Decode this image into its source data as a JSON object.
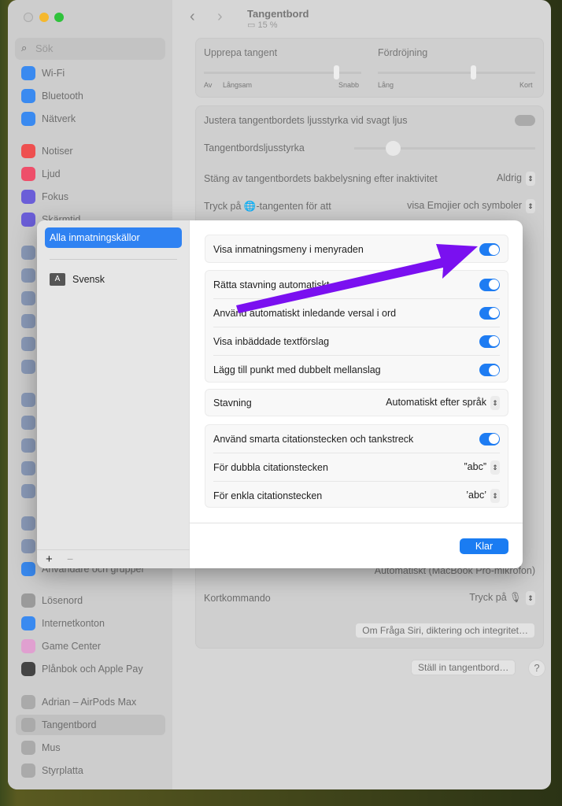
{
  "window": {
    "title": "Tangentbord",
    "battery": "15 %"
  },
  "sidebar": {
    "search_placeholder": "Sök",
    "items": [
      {
        "label": "Wi-Fi",
        "color": "#3a8af0"
      },
      {
        "label": "Bluetooth",
        "color": "#3a8af0"
      },
      {
        "label": "Nätverk",
        "color": "#3a8af0"
      },
      {
        "label": "Notiser",
        "color": "#ee5050"
      },
      {
        "label": "Ljud",
        "color": "#ee4f6a"
      },
      {
        "label": "Fokus",
        "color": "#6b5ed8"
      },
      {
        "label": "Skärmtid",
        "color": "#6b5ed8"
      },
      {
        "label": "Användare och grupper",
        "color": "#3a8af0"
      },
      {
        "label": "Lösenord",
        "color": "#9a9a9a"
      },
      {
        "label": "Internetkonton",
        "color": "#3a8af0"
      },
      {
        "label": "Game Center",
        "color": "#e0a0d0"
      },
      {
        "label": "Plånbok och Apple Pay",
        "color": "#444"
      },
      {
        "label": "Adrian – AirPods Max",
        "color": "#aaa"
      },
      {
        "label": "Tangentbord",
        "color": "#aaa",
        "selected": true
      },
      {
        "label": "Mus",
        "color": "#aaa"
      },
      {
        "label": "Styrplatta",
        "color": "#aaa"
      }
    ]
  },
  "main": {
    "repeat": {
      "label": "Upprepa tangent",
      "min": "Av",
      "slow": "Långsam",
      "fast": "Snabb",
      "value": 0.85
    },
    "delay": {
      "label": "Fördröjning",
      "long": "Lång",
      "short": "Kort",
      "value": 0.6
    },
    "backlight_auto": "Justera tangentbordets ljusstyrka vid svagt ljus",
    "brightness": {
      "label": "Tangentbordsljusstyrka",
      "value": 0.2
    },
    "backlight_off": {
      "label": "Stäng av tangentbordets bakbelysning efter inaktivitet",
      "value": "Aldrig"
    },
    "globe": {
      "label": "Tryck på 🌐-tangenten för att",
      "value": "visa Emojier och symboler"
    },
    "mic_value": "Automatiskt (MacBook Pro-mikrofon)",
    "shortcut": {
      "label": "Kortkommando",
      "value": "Tryck på 🎙"
    },
    "siri_privacy": "Om Fråga Siri, diktering och integritet…",
    "setup_keyboard": "Ställ in tangentbord…",
    "help": "?"
  },
  "sheet": {
    "sources": {
      "all": "Alla inmatningskällor",
      "items": [
        {
          "badge": "A",
          "label": "Svensk"
        }
      ],
      "add": "+",
      "remove": "−"
    },
    "menu_toggle": {
      "label": "Visa inmatningsmeny i menyraden",
      "on": true
    },
    "toggles": [
      {
        "label": "Rätta stavning automatiskt",
        "on": true
      },
      {
        "label": "Använd automatiskt inledande versal i ord",
        "on": true
      },
      {
        "label": "Visa inbäddade textförslag",
        "on": true
      },
      {
        "label": "Lägg till punkt med dubbelt mellanslag",
        "on": true
      }
    ],
    "spelling": {
      "label": "Stavning",
      "value": "Automatiskt efter språk"
    },
    "smart_quotes": {
      "label": "Använd smarta citationstecken och tankstreck",
      "on": true
    },
    "double": {
      "label": "För dubbla citationstecken",
      "value": "”abc”"
    },
    "single": {
      "label": "För enkla citationstecken",
      "value": "’abc’"
    },
    "done": "Klar"
  },
  "annotation": {
    "arrow_color": "#7a10f0"
  }
}
